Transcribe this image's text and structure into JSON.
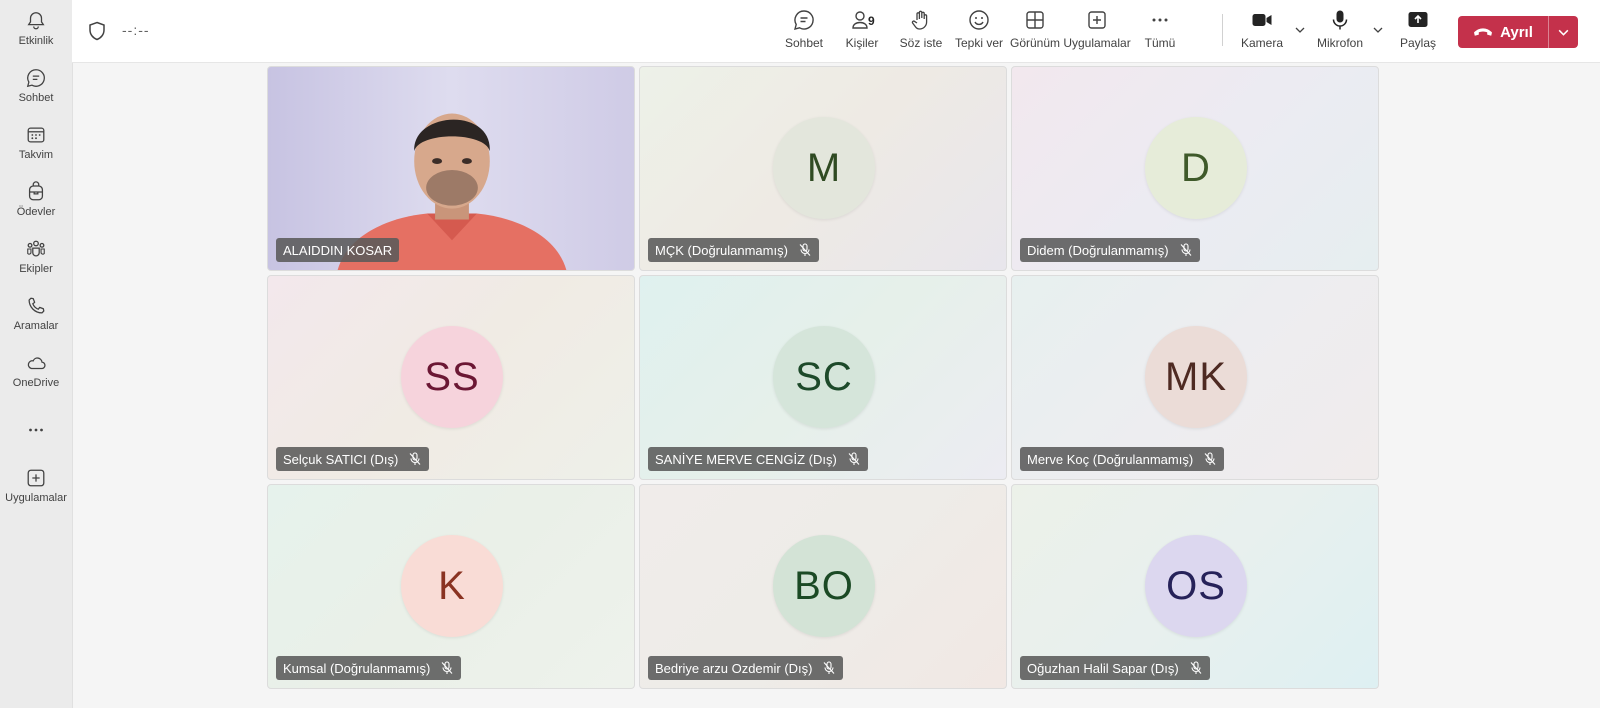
{
  "rail": {
    "items": [
      {
        "label": "Etkinlik",
        "icon": "bell-icon"
      },
      {
        "label": "Sohbet",
        "icon": "chat-icon"
      },
      {
        "label": "Takvim",
        "icon": "calendar-icon"
      },
      {
        "label": "Ödevler",
        "icon": "backpack-icon"
      },
      {
        "label": "Ekipler",
        "icon": "teams-icon"
      },
      {
        "label": "Aramalar",
        "icon": "phone-icon"
      },
      {
        "label": "OneDrive",
        "icon": "cloud-icon"
      },
      {
        "label": "",
        "icon": "more-icon"
      },
      {
        "label": "Uygulamalar",
        "icon": "add-app-icon"
      }
    ]
  },
  "header": {
    "timer": "--:--",
    "toolbar": {
      "chat": "Sohbet",
      "people": "Kişiler",
      "people_count": "9",
      "raise_hand": "Söz iste",
      "react": "Tepki ver",
      "view": "Görünüm",
      "apps": "Uygulamalar",
      "more": "Tümü",
      "camera": "Kamera",
      "mic": "Mikrofon",
      "share": "Paylaş",
      "leave": "Ayrıl"
    },
    "colors": {
      "leave": "#c4314b"
    }
  },
  "participants": [
    {
      "name": "ALAIDDIN KOSAR",
      "initials": "",
      "video": true,
      "muted": false
    },
    {
      "name": "MÇK (Doğrulanmamış)",
      "initials": "M",
      "avatar_bg": "#e3e6dc",
      "avatar_fg": "#2f4a22",
      "muted": true
    },
    {
      "name": "Didem (Doğrulanmamış)",
      "initials": "D",
      "avatar_bg": "#e6ecd9",
      "avatar_fg": "#3f5a2a",
      "muted": true
    },
    {
      "name": "Selçuk SATICI (Dış)",
      "initials": "SS",
      "avatar_bg": "#f6d3dc",
      "avatar_fg": "#6b1734",
      "muted": true
    },
    {
      "name": "SANİYE MERVE CENGİZ (Dış)",
      "initials": "SC",
      "avatar_bg": "#d5e5da",
      "avatar_fg": "#1d4a2a",
      "muted": true
    },
    {
      "name": "Merve Koç (Doğrulanmamış)",
      "initials": "MK",
      "avatar_bg": "#ebdcd7",
      "avatar_fg": "#4e2a22",
      "muted": true
    },
    {
      "name": "Kumsal (Doğrulanmamış)",
      "initials": "K",
      "avatar_bg": "#f9dcd6",
      "avatar_fg": "#8a3322",
      "muted": true
    },
    {
      "name": "Bedriye arzu Ozdemir (Dış)",
      "initials": "BO",
      "avatar_bg": "#d3e3d6",
      "avatar_fg": "#1b4a25",
      "muted": true
    },
    {
      "name": "Oğuzhan Halil Sapar (Dış)",
      "initials": "OS",
      "avatar_bg": "#dcd7ef",
      "avatar_fg": "#262259",
      "muted": true
    }
  ]
}
